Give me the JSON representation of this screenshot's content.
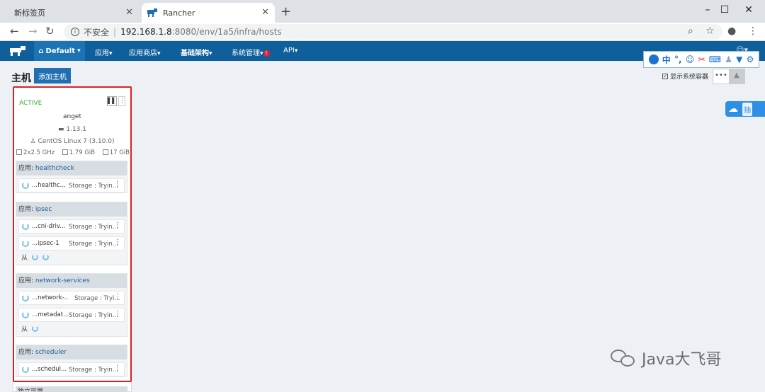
{
  "browser": {
    "tabs": [
      {
        "label": "新标签页",
        "active": false
      },
      {
        "label": "Rancher",
        "active": true
      }
    ],
    "new_tab_symbol": "+",
    "window_controls": {
      "minimize": "–",
      "maximize": "☐",
      "close": "✕"
    },
    "address": {
      "insecure_label": "不安全",
      "separator": "|",
      "host": "192.168.1.8",
      "path": ":8080/env/1a5/infra/hosts"
    }
  },
  "header": {
    "environment": "Default",
    "menu": [
      {
        "label": "应用",
        "bold": false
      },
      {
        "label": "应用商店",
        "bold": false
      },
      {
        "label": "基础架构",
        "bold": true
      },
      {
        "label": "系统管理",
        "bold": false,
        "alert": "!"
      },
      {
        "label": "API",
        "bold": false
      }
    ]
  },
  "ime_toolbar": {
    "lang": "中",
    "punct": "°,"
  },
  "side_badge": {
    "text": "抽"
  },
  "page": {
    "title": "主机",
    "add_host_label": "添加主机",
    "show_system_label": "显示系统容器",
    "show_system_checked": true
  },
  "host": {
    "state": "ACTIVE",
    "name": "anget",
    "docker_version": "1.13.1",
    "os": "CentOS Linux 7 (3.10.0)",
    "cpu": "2x2.5 GHz",
    "memory": "1.79 GiB",
    "disk": "17 GiB"
  },
  "stacks": [
    {
      "label": "应用: ",
      "name": "healthcheck",
      "services": [
        {
          "name": "...healthc...",
          "state": "Storage : Tryin..."
        }
      ],
      "sidekick_label": ""
    },
    {
      "label": "应用: ",
      "name": "ipsec",
      "services": [
        {
          "name": "...cni-driv...",
          "state": "Storage : Tryin..."
        },
        {
          "name": "...ipsec-1",
          "state": "Storage : Tryin..."
        }
      ],
      "sidekick_label": "从"
    },
    {
      "label": "应用: ",
      "name": "network-services",
      "services": [
        {
          "name": "...network-...",
          "state": "Storage : Tryi..."
        },
        {
          "name": "...metadat...",
          "state": "Storage : Tryin..."
        }
      ],
      "sidekick_label": "从"
    },
    {
      "label": "应用: ",
      "name": "scheduler",
      "services": [
        {
          "name": "...schedul...",
          "state": "Storage : Tryin..."
        }
      ],
      "sidekick_label": ""
    }
  ],
  "standalone_label": "独立容器",
  "watermark": {
    "text": "Java大飞哥"
  },
  "colors": {
    "header_bg": "#0f5f9b",
    "active_state": "#3aaa35",
    "highlight": "#e02020",
    "page_bg": "#edf1f5"
  }
}
